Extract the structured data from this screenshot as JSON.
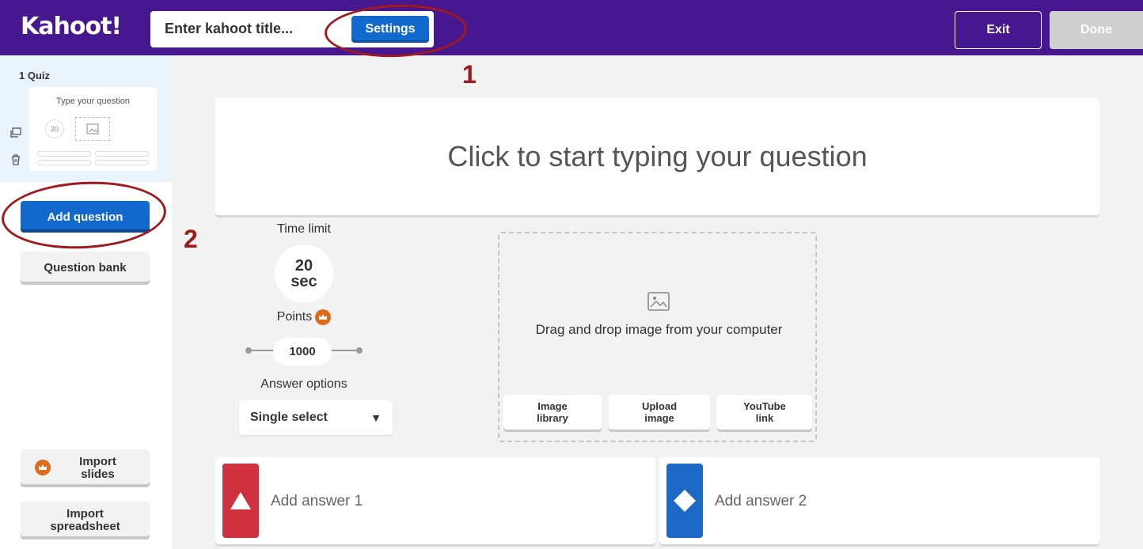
{
  "header": {
    "logo": "Kahoot!",
    "title_placeholder": "Enter kahoot title...",
    "settings_label": "Settings",
    "exit_label": "Exit",
    "done_label": "Done"
  },
  "annotations": {
    "one": "1",
    "two": "2"
  },
  "sidebar": {
    "slide_label": "1  Quiz",
    "thumb_question": "Type your question",
    "thumb_timer": "20",
    "add_question_label": "Add question",
    "question_bank_label": "Question bank",
    "import_slides_label_1": "Import",
    "import_slides_label_2": "slides",
    "import_sheet_label_1": "Import",
    "import_sheet_label_2": "spreadsheet"
  },
  "question": {
    "placeholder": "Click to start typing your question"
  },
  "settings_panel": {
    "time_limit_label": "Time limit",
    "time_value": "20",
    "time_unit": "sec",
    "points_label": "Points",
    "points_value": "1000",
    "answer_options_label": "Answer options",
    "answer_options_selected": "Single select"
  },
  "media": {
    "drop_text": "Drag and drop image from your computer",
    "image_library_1": "Image",
    "image_library_2": "library",
    "upload_image_1": "Upload",
    "upload_image_2": "image",
    "youtube_1": "YouTube",
    "youtube_2": "link"
  },
  "answers": [
    {
      "placeholder": "Add answer 1",
      "color": "#d0313e",
      "shape": "triangle"
    },
    {
      "placeholder": "Add answer 2",
      "color": "#1e68c8",
      "shape": "diamond"
    }
  ],
  "colors": {
    "header": "#46178f",
    "primary": "#1368ce",
    "annotation": "#a1191d"
  }
}
